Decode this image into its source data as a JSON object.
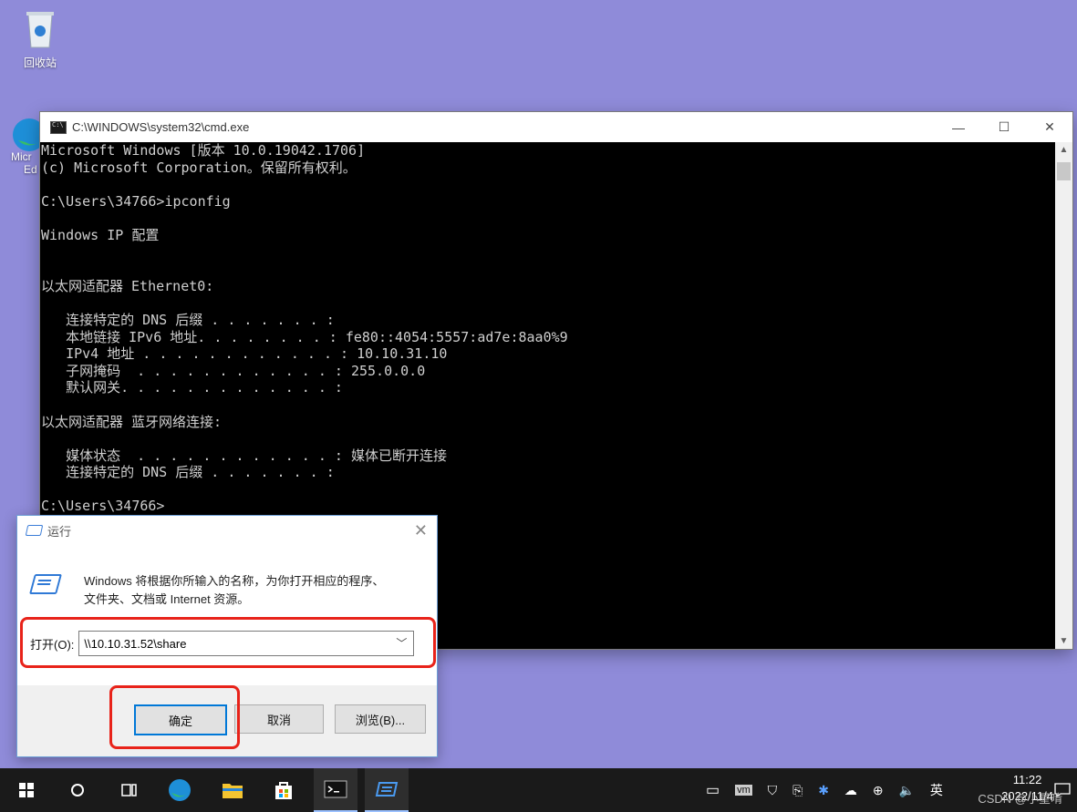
{
  "desktop": {
    "recycle_label": "回收站",
    "edge_label_line1": "Micr",
    "edge_label_line2": "Ed"
  },
  "cmd": {
    "title": "C:\\WINDOWS\\system32\\cmd.exe",
    "lines": [
      "Microsoft Windows [版本 10.0.19042.1706]",
      "(c) Microsoft Corporation。保留所有权利。",
      "",
      "C:\\Users\\34766>ipconfig",
      "",
      "Windows IP 配置",
      "",
      "",
      "以太网适配器 Ethernet0:",
      "",
      "   连接特定的 DNS 后缀 . . . . . . . :",
      "   本地链接 IPv6 地址. . . . . . . . : fe80::4054:5557:ad7e:8aa0%9",
      "   IPv4 地址 . . . . . . . . . . . . : 10.10.31.10",
      "   子网掩码  . . . . . . . . . . . . : 255.0.0.0",
      "   默认网关. . . . . . . . . . . . . :",
      "",
      "以太网适配器 蓝牙网络连接:",
      "",
      "   媒体状态  . . . . . . . . . . . . : 媒体已断开连接",
      "   连接特定的 DNS 后缀 . . . . . . . :",
      "",
      "C:\\Users\\34766>"
    ]
  },
  "run_dialog": {
    "title": "运行",
    "description_line1": "Windows 将根据你所输入的名称，为你打开相应的程序、",
    "description_line2": "文件夹、文档或 Internet 资源。",
    "open_label": "打开(O):",
    "open_value": "\\\\10.10.31.52\\share",
    "ok_label": "确定",
    "cancel_label": "取消",
    "browse_label": "浏览(B)..."
  },
  "taskbar": {
    "ime": "英",
    "time": "11:22",
    "date": "2022/11/4",
    "watermark": "CSDN @小星啃"
  }
}
